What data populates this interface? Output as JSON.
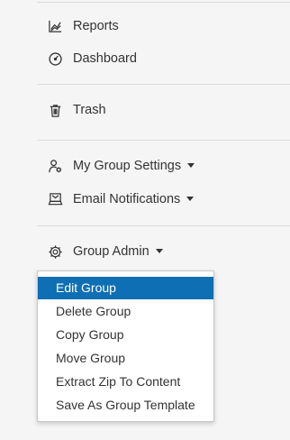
{
  "nav": {
    "reports": {
      "label": "Reports",
      "icon": "line-chart-icon"
    },
    "dashboard": {
      "label": "Dashboard",
      "icon": "gauge-icon"
    },
    "trash": {
      "label": "Trash",
      "icon": "trash-icon"
    },
    "my_group_settings": {
      "label": "My Group Settings",
      "icon": "user-gear-icon"
    },
    "email_notifications": {
      "label": "Email Notifications",
      "icon": "laptop-mail-icon"
    },
    "group_admin": {
      "label": "Group Admin",
      "icon": "gear-icon"
    }
  },
  "group_admin_menu": {
    "items": [
      {
        "label": "Edit Group",
        "active": true
      },
      {
        "label": "Delete Group"
      },
      {
        "label": "Copy Group"
      },
      {
        "label": "Move Group"
      },
      {
        "label": "Extract Zip To Content"
      },
      {
        "label": "Save As Group Template"
      }
    ]
  },
  "colors": {
    "background": "#f5f5f5",
    "text": "#333333",
    "divider": "#dcdcdc",
    "active_item": "#0f6fb4"
  }
}
